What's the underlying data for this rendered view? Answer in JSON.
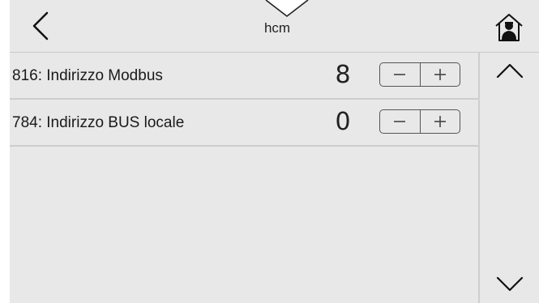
{
  "header": {
    "title": "hcm"
  },
  "icons": {
    "back": "chevron-left-icon",
    "menu_toggle": "chevron-down-icon",
    "home": "home-user-icon",
    "scroll_up": "chevron-up-icon",
    "scroll_down": "chevron-down-icon"
  },
  "parameters": [
    {
      "label": "816: Indirizzo Modbus",
      "value": "8"
    },
    {
      "label": "784: Indirizzo BUS locale",
      "value": "0"
    }
  ],
  "colors": {
    "panel_bg": "#e8e8e8",
    "divider": "#cdcdcd",
    "text": "#1a1a1a"
  }
}
